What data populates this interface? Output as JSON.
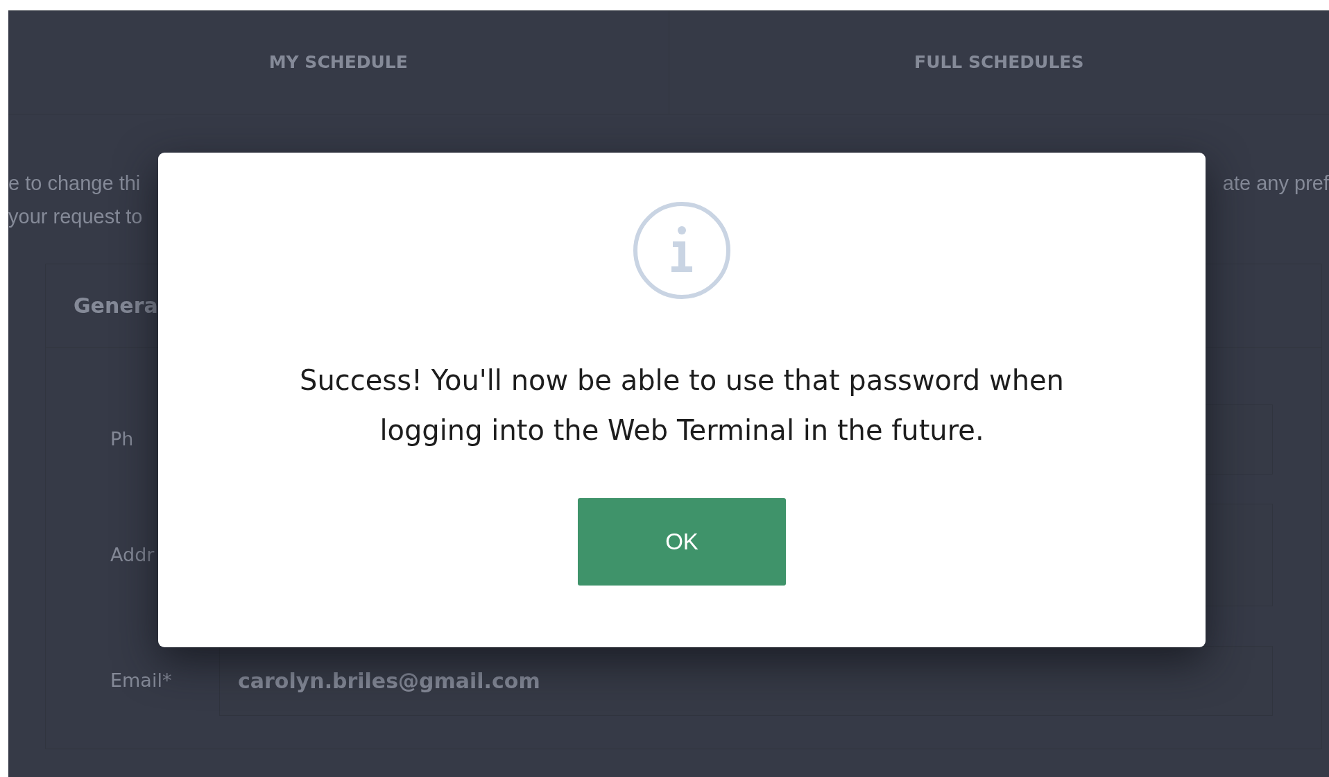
{
  "tabs": [
    {
      "label": "MY SCHEDULE"
    },
    {
      "label": "FULL SCHEDULES"
    }
  ],
  "intro": {
    "left_lines": [
      "e to change thi",
      "your request to"
    ],
    "right_lines": [
      "ate any pref"
    ]
  },
  "card": {
    "title": "Genera",
    "fields": [
      {
        "label": "Ph",
        "kind": "text"
      },
      {
        "label": "Addr",
        "kind": "textarea"
      },
      {
        "label": "Email*",
        "kind": "text",
        "value": "carolyn.briles@gmail.com"
      }
    ]
  },
  "dialog": {
    "message": "Success! You'll now be able to use that password when logging into the Web Terminal in the future.",
    "button": "OK"
  }
}
